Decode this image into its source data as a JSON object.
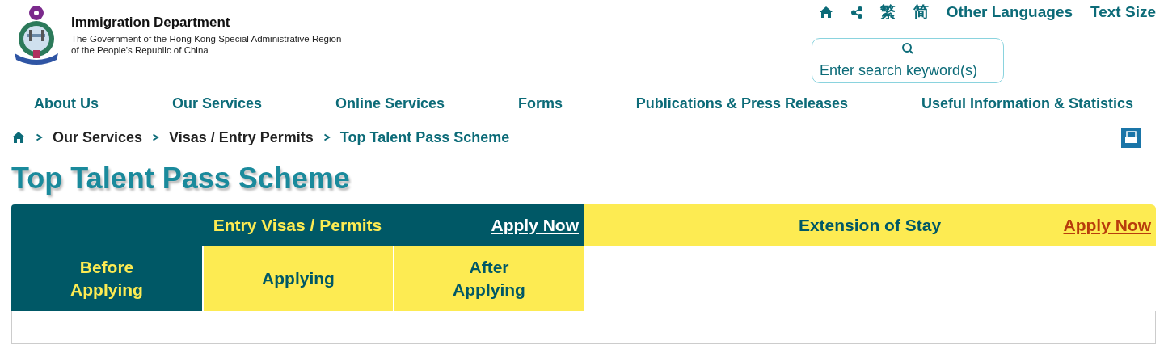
{
  "header": {
    "org_name": "Immigration Department",
    "org_subtitle": [
      "The Government of the Hong Kong Special Administrative Region",
      "of the People's Republic of China"
    ]
  },
  "utility_links": [
    {
      "kind": "home"
    },
    {
      "kind": "share"
    },
    {
      "kind": "text",
      "label": "繁"
    },
    {
      "kind": "text",
      "label": "简"
    },
    {
      "kind": "text",
      "label": "Other Languages"
    },
    {
      "kind": "text",
      "label": "Text Size"
    }
  ],
  "search": {
    "placeholder": "Enter search keyword(s)"
  },
  "nav": [
    "About Us",
    "Our Services",
    "Online Services",
    "Forms",
    "Publications & Press Releases",
    "Useful Information & Statistics"
  ],
  "breadcrumb": [
    {
      "label": "Our Services",
      "current": false
    },
    {
      "label": "Visas / Entry Permits",
      "current": false
    },
    {
      "label": "Top Talent Pass Scheme",
      "current": true
    }
  ],
  "page_title": "Top Talent Pass Scheme",
  "main_tabs": [
    {
      "label": "Entry Visas / Permits",
      "link": "Apply Now",
      "selected": true
    },
    {
      "label": "Extension of Stay",
      "link": "Apply Now",
      "selected": false
    }
  ],
  "sub_tabs": [
    {
      "label": "Before Applying",
      "selected": true
    },
    {
      "label": "Applying",
      "selected": false
    },
    {
      "label": "After Applying",
      "selected": false
    }
  ]
}
